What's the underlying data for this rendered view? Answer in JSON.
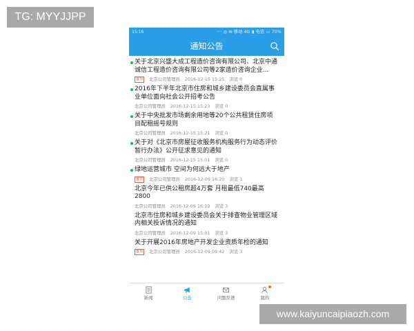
{
  "watermarks": {
    "top_left": "TG: MYYJJPP",
    "bottom_right": "www.kaiyuncaipiaozh.com"
  },
  "status_bar": {
    "time": "15:16",
    "icons_text": "··· ◎ ✉ 移动 4G ▮ 电信 ▭ 70%"
  },
  "header": {
    "title": "通知公告",
    "search_icon": "search-icon"
  },
  "colors": {
    "primary": "#2a9ee6",
    "dot": "#2bb24c",
    "tag": "#e25a4d",
    "badge": "#f06b2a"
  },
  "list": [
    {
      "title": "关于北京兴盛大成工程造价咨询有限公司、北京中通诚信工程造价咨询有限公司等2家造价咨询企业...",
      "tag": "置顶",
      "author": "北京公司管理员",
      "time": "2016-12-15 15:25",
      "views": "浏览 0",
      "unread": true
    },
    {
      "title": "2016年下半年北京市住房和城乡建设委员会直属事业单位面向社会公开招考公告",
      "tag": "",
      "author": "北京公司管理员",
      "time": "2016-12-15 15:23",
      "views": "浏览 0",
      "unread": true
    },
    {
      "title": "关于中央批发市场剩余用地等20个公共租赁住房项目配租摇号规则",
      "tag": "",
      "author": "北京公司管理员",
      "time": "2016-12-15 15:21",
      "views": "浏览 0",
      "unread": true
    },
    {
      "title": "关于对《北京市房屋征收服务机构服务行为动态评价暂行办法》公开征求意见的通知",
      "tag": "",
      "author": "北京公司管理员",
      "time": "2016-12-15 15:01",
      "views": "浏览 0",
      "unread": true
    },
    {
      "title": "绿地运营城市 空间为何远大于地产",
      "tag": "置顶",
      "author": "北京公司管理员",
      "time": "2016-12-09 16:20",
      "views": "浏览 1",
      "unread": true
    },
    {
      "title": "北京今年已供公租房超4万套 月租最低740最高2800",
      "tag": "",
      "author": "北京公司管理员",
      "time": "2016-12-09 16:19",
      "views": "浏览 3",
      "unread": false
    },
    {
      "title": "北京市住房和城乡建设委员会关于排查物业管理区域内相关投诉情况的通知",
      "tag": "",
      "author": "北京公司管理员",
      "time": "2016-12-09 15:01",
      "views": "浏览 3",
      "unread": false
    },
    {
      "title": "关于开展2016年房地产开发企业资质年检的通知",
      "tag": "置顶",
      "author": "北京公司管理员",
      "time": "2016-12-09 09:42",
      "views": "浏览 3",
      "unread": false
    }
  ],
  "tabs": [
    {
      "label": "新闻",
      "icon": "news-icon"
    },
    {
      "label": "公告",
      "icon": "megaphone-icon"
    },
    {
      "label": "问题反馈",
      "icon": "mail-icon"
    },
    {
      "label": "我的",
      "icon": "user-icon"
    }
  ]
}
